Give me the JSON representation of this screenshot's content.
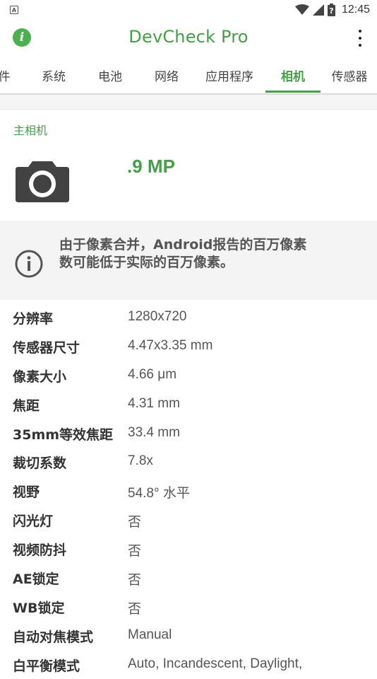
{
  "status_bar": {
    "notification_icon": "A",
    "icons": [
      "wifi-icon",
      "signal-icon",
      "battery-icon"
    ],
    "time": "12:45"
  },
  "app_bar": {
    "title": "DevCheck Pro",
    "left_icon": "info-icon",
    "right_icon": "overflow-menu-icon"
  },
  "tabs": [
    {
      "label": "件",
      "active": false
    },
    {
      "label": "系统",
      "active": false
    },
    {
      "label": "电池",
      "active": false
    },
    {
      "label": "网络",
      "active": false
    },
    {
      "label": "应用程序",
      "active": false
    },
    {
      "label": "相机",
      "active": true
    },
    {
      "label": "传感器",
      "active": false
    }
  ],
  "camera": {
    "section_title": "主相机",
    "megapixels": ".9 MP",
    "icon": "camera-icon"
  },
  "notice": {
    "icon": "info-outline-icon",
    "text_line1": "由于像素合并，Android报告的百万像素",
    "text_line2": "数可能低于实际的百万像素。"
  },
  "properties": [
    {
      "label": "分辨率",
      "value": "1280x720"
    },
    {
      "label": "传感器尺寸",
      "value": "4.47x3.35 mm"
    },
    {
      "label": "像素大小",
      "value": "4.66 μm"
    },
    {
      "label": "焦距",
      "value": "4.31 mm"
    },
    {
      "label": "35mm等效焦距",
      "value": "33.4 mm"
    },
    {
      "label": "裁切系数",
      "value": "7.8x"
    },
    {
      "label": "视野",
      "value": "54.8° 水平"
    },
    {
      "label": "闪光灯",
      "value": "否"
    },
    {
      "label": "视频防抖",
      "value": "否"
    },
    {
      "label": "AE锁定",
      "value": "否"
    },
    {
      "label": "WB锁定",
      "value": "否"
    },
    {
      "label": "自动对焦模式",
      "value": "Manual"
    },
    {
      "label": "白平衡模式",
      "value": "Auto, Incandescent, Daylight,"
    }
  ],
  "colors": {
    "accent": "#43a047",
    "notice_background": "#f4f4f4"
  }
}
